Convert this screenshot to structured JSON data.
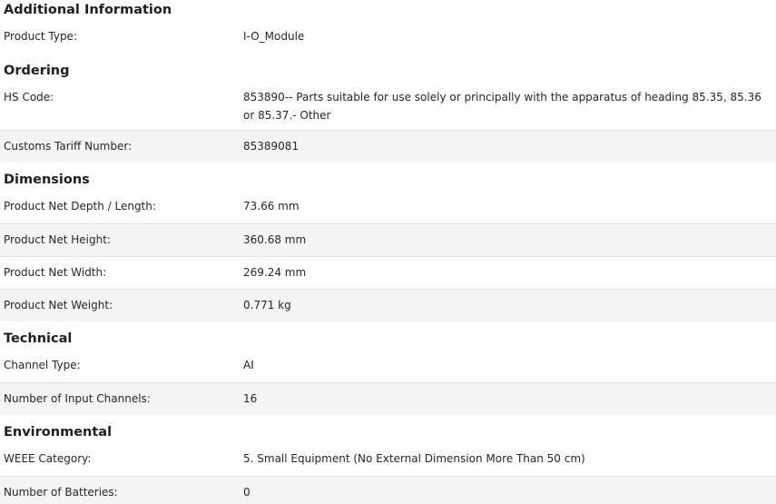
{
  "sections": {
    "additional": {
      "title": "Additional Information",
      "rows": [
        {
          "label": "Product Type:",
          "value": "I-O_Module"
        }
      ]
    },
    "ordering": {
      "title": "Ordering",
      "rows": [
        {
          "label": "HS Code:",
          "value": "853890-- Parts suitable for use solely or principally with the apparatus of heading 85.35, 85.36 or 85.37.- Other"
        },
        {
          "label": "Customs Tariff Number:",
          "value": "85389081"
        }
      ]
    },
    "dimensions": {
      "title": "Dimensions",
      "rows": [
        {
          "label": "Product Net Depth / Length:",
          "value": "73.66 mm"
        },
        {
          "label": "Product Net Height:",
          "value": "360.68 mm"
        },
        {
          "label": "Product Net Width:",
          "value": "269.24 mm"
        },
        {
          "label": "Product Net Weight:",
          "value": "0.771 kg"
        }
      ]
    },
    "technical": {
      "title": "Technical",
      "rows": [
        {
          "label": "Channel Type:",
          "value": "AI"
        },
        {
          "label": "Number of Input Channels:",
          "value": "16"
        }
      ]
    },
    "environmental": {
      "title": "Environmental",
      "rows": [
        {
          "label": "WEEE Category:",
          "value": "5. Small Equipment (No External Dimension More Than 50 cm)"
        },
        {
          "label": "Number of Batteries:",
          "value": "0"
        }
      ]
    }
  }
}
